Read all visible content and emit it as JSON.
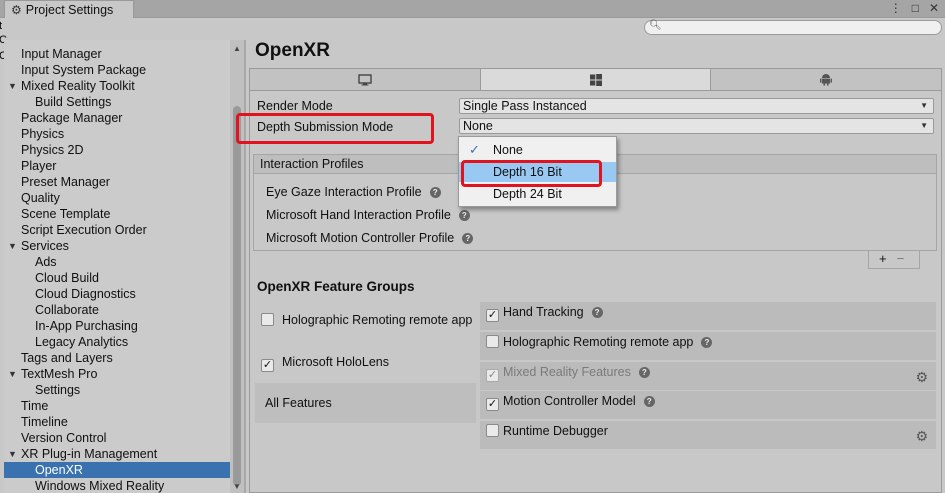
{
  "window": {
    "tab_title": "Project Settings",
    "controls": [
      "⋮",
      "□",
      "✕"
    ]
  },
  "search": {
    "placeholder": ""
  },
  "left_edge": [
    "t",
    "C",
    "C"
  ],
  "sidebar": {
    "items": [
      {
        "label": "Input Manager",
        "indent": 0,
        "expandable": false
      },
      {
        "label": "Input System Package",
        "indent": 0,
        "expandable": false
      },
      {
        "label": "Mixed Reality Toolkit",
        "indent": 0,
        "expandable": true
      },
      {
        "label": "Build Settings",
        "indent": 1,
        "expandable": false
      },
      {
        "label": "Package Manager",
        "indent": 0,
        "expandable": false
      },
      {
        "label": "Physics",
        "indent": 0,
        "expandable": false
      },
      {
        "label": "Physics 2D",
        "indent": 0,
        "expandable": false
      },
      {
        "label": "Player",
        "indent": 0,
        "expandable": false
      },
      {
        "label": "Preset Manager",
        "indent": 0,
        "expandable": false
      },
      {
        "label": "Quality",
        "indent": 0,
        "expandable": false
      },
      {
        "label": "Scene Template",
        "indent": 0,
        "expandable": false
      },
      {
        "label": "Script Execution Order",
        "indent": 0,
        "expandable": false
      },
      {
        "label": "Services",
        "indent": 0,
        "expandable": true
      },
      {
        "label": "Ads",
        "indent": 1,
        "expandable": false
      },
      {
        "label": "Cloud Build",
        "indent": 1,
        "expandable": false
      },
      {
        "label": "Cloud Diagnostics",
        "indent": 1,
        "expandable": false
      },
      {
        "label": "Collaborate",
        "indent": 1,
        "expandable": false
      },
      {
        "label": "In-App Purchasing",
        "indent": 1,
        "expandable": false
      },
      {
        "label": "Legacy Analytics",
        "indent": 1,
        "expandable": false
      },
      {
        "label": "Tags and Layers",
        "indent": 0,
        "expandable": false
      },
      {
        "label": "TextMesh Pro",
        "indent": 0,
        "expandable": true
      },
      {
        "label": "Settings",
        "indent": 1,
        "expandable": false
      },
      {
        "label": "Time",
        "indent": 0,
        "expandable": false
      },
      {
        "label": "Timeline",
        "indent": 0,
        "expandable": false
      },
      {
        "label": "Version Control",
        "indent": 0,
        "expandable": false
      },
      {
        "label": "XR Plug-in Management",
        "indent": 0,
        "expandable": true
      },
      {
        "label": "OpenXR",
        "indent": 1,
        "expandable": false,
        "selected": true
      },
      {
        "label": "Windows Mixed Reality",
        "indent": 1,
        "expandable": false
      }
    ]
  },
  "main": {
    "title": "OpenXR",
    "platform_tabs": [
      {
        "icon": "monitor-icon",
        "active": false
      },
      {
        "icon": "windows-icon",
        "active": true
      },
      {
        "icon": "android-icon",
        "active": false
      }
    ],
    "render_mode": {
      "label": "Render Mode",
      "value": "Single Pass Instanced"
    },
    "depth_submission": {
      "label": "Depth Submission Mode",
      "value": "None"
    },
    "depth_menu": {
      "options": [
        "None",
        "Depth 16 Bit",
        "Depth 24 Bit"
      ],
      "checked": "None",
      "highlighted": "Depth 16 Bit"
    },
    "interaction_profiles": {
      "header": "Interaction Profiles",
      "items": [
        "Eye Gaze Interaction Profile",
        "Microsoft Hand Interaction Profile",
        "Microsoft Motion Controller Profile"
      ],
      "add": "+",
      "remove": "−"
    },
    "feature_groups": {
      "title": "OpenXR Feature Groups",
      "groups": [
        {
          "label": "Holographic Remoting remote app",
          "checked": false
        },
        {
          "label": "Microsoft HoloLens",
          "checked": true
        }
      ],
      "all_features": "All Features",
      "features": [
        {
          "label": "Hand Tracking",
          "checked": true,
          "disabled": false,
          "gear": false
        },
        {
          "label": "Holographic Remoting remote app",
          "checked": false,
          "disabled": false,
          "gear": false
        },
        {
          "label": "Mixed Reality Features",
          "checked": true,
          "disabled": true,
          "gear": true
        },
        {
          "label": "Motion Controller Model",
          "checked": true,
          "disabled": false,
          "gear": false
        },
        {
          "label": "Runtime Debugger",
          "checked": false,
          "disabled": false,
          "gear": true
        }
      ]
    }
  },
  "colors": {
    "selection": "#3a72b0",
    "highlight": "#99c9f3",
    "annotation_red": "#e0141e"
  }
}
